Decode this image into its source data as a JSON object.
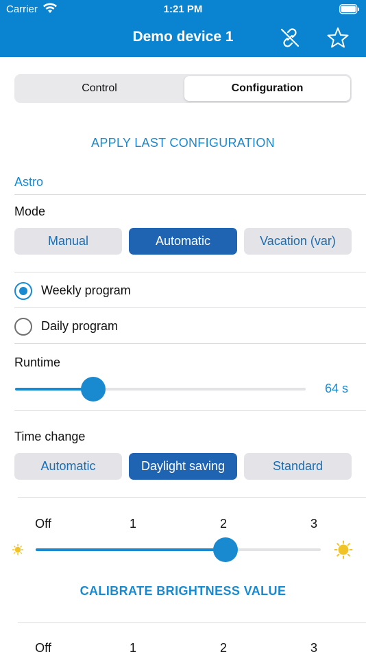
{
  "status": {
    "carrier": "Carrier",
    "time": "1:21 PM"
  },
  "header": {
    "title": "Demo device 1",
    "icons": [
      "unlink-icon",
      "star-icon"
    ]
  },
  "tabs": {
    "items": [
      "Control",
      "Configuration"
    ],
    "selected": "Configuration"
  },
  "apply_button": "APPLY LAST CONFIGURATION",
  "section": "Astro",
  "mode": {
    "label": "Mode",
    "options": [
      "Manual",
      "Automatic",
      "Vacation (var)"
    ],
    "selected": "Automatic"
  },
  "program": {
    "options": [
      "Weekly program",
      "Daily program"
    ],
    "selected": "Weekly program"
  },
  "runtime": {
    "label": "Runtime",
    "value_text": "64 s",
    "fraction": 0.27
  },
  "time_change": {
    "label": "Time change",
    "options": [
      "Automatic",
      "Daylight saving",
      "Standard"
    ],
    "selected": "Daylight saving"
  },
  "brightness_1": {
    "ticks": [
      "Off",
      "1",
      "2",
      "3"
    ],
    "level": 2
  },
  "calibrate_button": "CALIBRATE BRIGHTNESS VALUE",
  "brightness_2": {
    "ticks": [
      "Off",
      "1",
      "2",
      "3"
    ]
  },
  "colors": {
    "accent": "#1a8ad0",
    "header": "#0a84d0",
    "selected_pill": "#1f63b3"
  }
}
